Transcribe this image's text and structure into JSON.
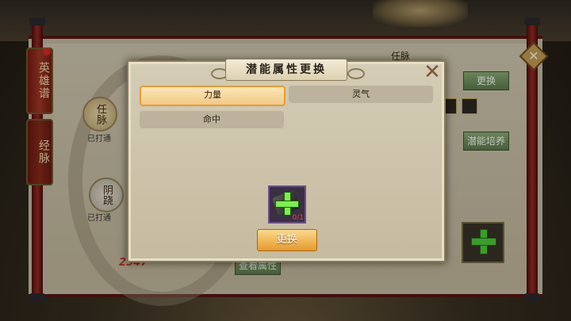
{
  "background": {
    "tabs": [
      "英雄谱",
      "经脉"
    ],
    "meridian_nodes": [
      {
        "name": "任脉",
        "status": "已打通"
      },
      {
        "name": "阴跷",
        "status": "已打通"
      }
    ],
    "right_header": "任脉",
    "replace_label": "更换",
    "cultivate_label": "潜能培养",
    "view_attr_label": "查看属性",
    "power_text": "2547"
  },
  "modal": {
    "title": "潜能属性更换",
    "options": [
      {
        "label": "力量",
        "selected": true
      },
      {
        "label": "灵气",
        "selected": false
      },
      {
        "label": "命中",
        "selected": false
      }
    ],
    "item_slot": {
      "count": "0/1"
    },
    "confirm_label": "更换"
  },
  "colors": {
    "selected_border": "#e89b38",
    "confirm_button": "#e69a2c",
    "plus_green": "#4fd13a"
  }
}
